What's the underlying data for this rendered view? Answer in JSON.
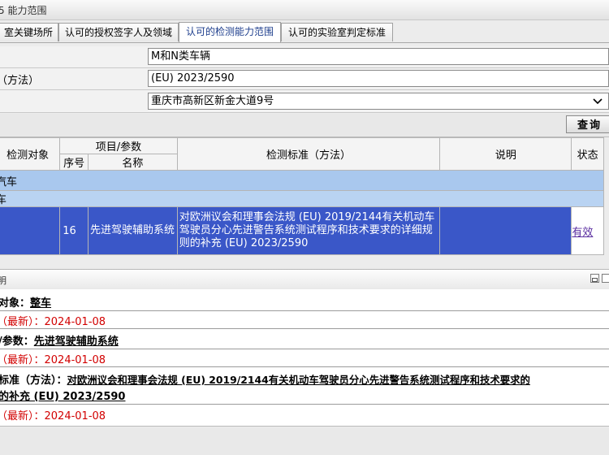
{
  "titlebar": {
    "label": "5  能力范围"
  },
  "tabs": [
    "室关键场所",
    "认可的授权签字人及领域",
    "认可的检测能力范围",
    "认可的实验室判定标准"
  ],
  "form": {
    "field1_value": "M和N类车辆",
    "field2_label": "（方法）",
    "field2_value": "(EU) 2023/2590",
    "address_value": "重庆市高新区新金大道9号"
  },
  "query_button": "查询",
  "grid": {
    "headers": {
      "object": "检测对象",
      "item_param": "项目/参数",
      "seq": "序号",
      "name": "名称",
      "standard": "检测标准（方法）",
      "note": "说明",
      "status": "状态"
    },
    "group1": "汽车",
    "group2": "车",
    "row": {
      "seq": "16",
      "name": "先进驾驶辅助系统",
      "standard": "对欧洲议会和理事会法规 (EU) 2019/2144有关机动车驾驶员分心先进警告系统测试程序和技术要求的详细规则的补充 (EU) 2023/2590",
      "note": "",
      "status": "有效"
    }
  },
  "detail": {
    "header": "明",
    "object_label": "对象：",
    "object_value": "整车",
    "date1": "（最新）：2024-01-08",
    "param_label": "/参数：",
    "param_value": "先进驾驶辅助系统",
    "date2": "（最新）：2024-01-08",
    "standard_label": "标准（方法）：",
    "standard_value_line1": "对欧洲议会和理事会法规 (EU) 2019/2144有关机动车驾驶员分心先进警告系统测试程序和技术要求的",
    "standard_value_line2": "的补充 (EU) 2023/2590",
    "date3": "（最新）：2024-01-08"
  }
}
